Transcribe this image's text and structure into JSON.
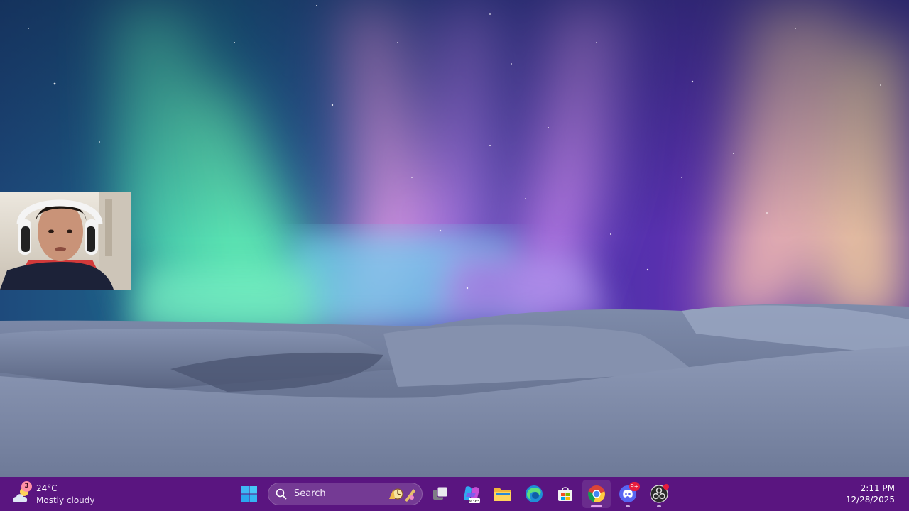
{
  "colors": {
    "taskbar": "#5a1580",
    "badge_red": "#e81d3d",
    "aurora_green": "#5fe7b4",
    "aurora_pink": "#e6a3ee",
    "aurora_peach": "#f4c8a8",
    "snow": "#8e9ab7"
  },
  "weather": {
    "icon": "cloud-sun-icon",
    "badge": "3",
    "temperature": "24°C",
    "condition": "Mostly cloudy"
  },
  "taskbar": {
    "start_icon": "windows-logo-icon",
    "search_placeholder": "Search",
    "pinned": [
      {
        "name": "task-view",
        "icon": "task-view-icon"
      },
      {
        "name": "microsoft-365-copilot",
        "icon": "m365-icon",
        "caption": "M365"
      },
      {
        "name": "file-explorer",
        "icon": "folder-icon"
      },
      {
        "name": "edge",
        "icon": "edge-icon"
      },
      {
        "name": "microsoft-store",
        "icon": "store-icon"
      },
      {
        "name": "chrome",
        "icon": "chrome-icon",
        "active": true
      },
      {
        "name": "discord",
        "icon": "discord-icon",
        "badge": "9+"
      },
      {
        "name": "obs-studio",
        "icon": "obs-icon",
        "badge_dot": true
      }
    ]
  },
  "clock": {
    "time": "2:11 PM",
    "date": "12/28/2025"
  }
}
